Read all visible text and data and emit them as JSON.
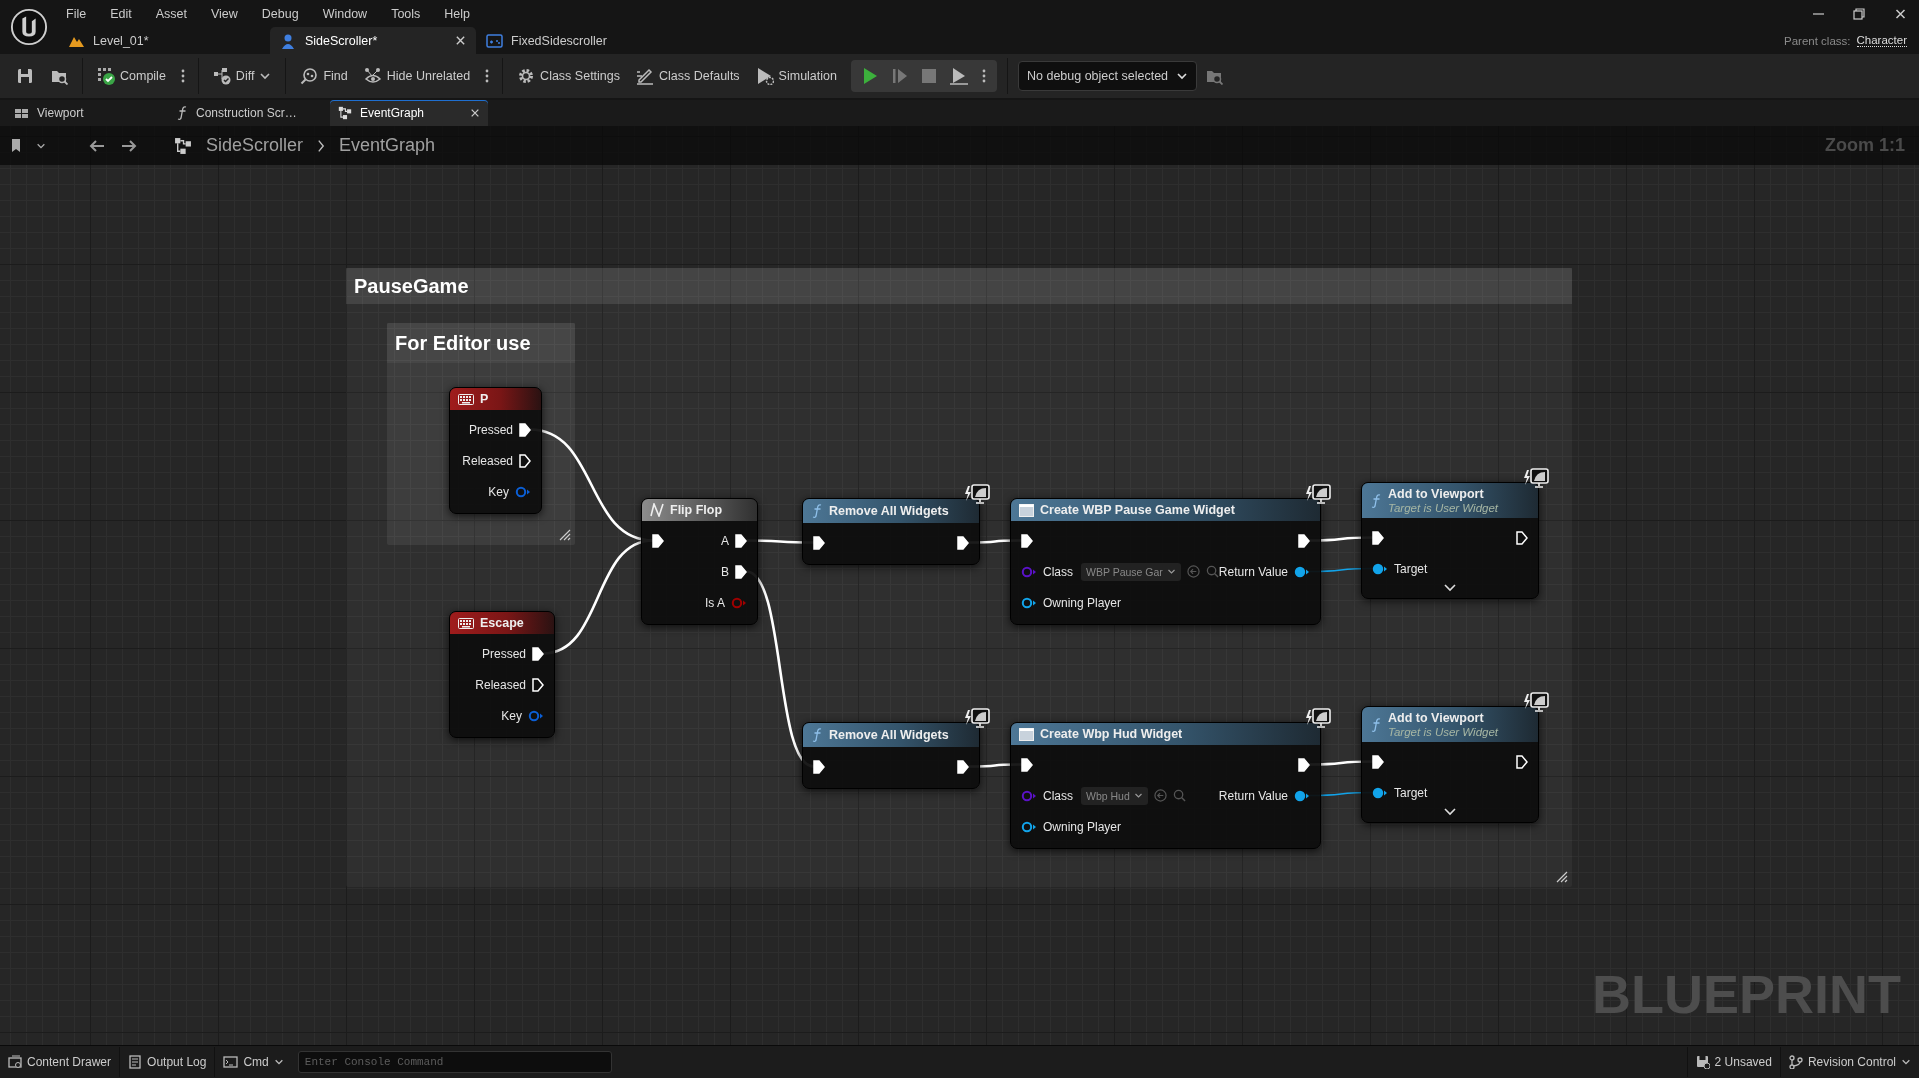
{
  "menu": [
    "File",
    "Edit",
    "Asset",
    "View",
    "Debug",
    "Window",
    "Tools",
    "Help"
  ],
  "document_tabs": [
    {
      "label": "Level_01*",
      "selected": false
    },
    {
      "label": "SideScroller*",
      "selected": true
    },
    {
      "label": "FixedSidescroller",
      "selected": false
    }
  ],
  "parent_class": {
    "label": "Parent class:",
    "value": "Character"
  },
  "toolbar": {
    "compile": "Compile",
    "diff": "Diff",
    "find": "Find",
    "hide_unrelated": "Hide Unrelated",
    "class_settings": "Class Settings",
    "class_defaults": "Class Defaults",
    "simulation": "Simulation",
    "debug_object": "No debug object selected"
  },
  "graph_tabs": [
    {
      "label": "Viewport",
      "selected": false
    },
    {
      "label": "Construction Scr…",
      "selected": false
    },
    {
      "label": "EventGraph",
      "selected": true
    }
  ],
  "breadcrumb": [
    "SideScroller",
    "EventGraph"
  ],
  "zoom_label": "Zoom 1:1",
  "comments": [
    {
      "title": "PauseGame"
    },
    {
      "title": "For Editor use"
    }
  ],
  "nodes": [
    {
      "kind": "event",
      "title": "P",
      "ui_badge": false,
      "outputs": [
        {
          "label": "Pressed",
          "kind": "exec",
          "connected": true
        },
        {
          "label": "Released",
          "kind": "exec",
          "connected": false
        },
        {
          "label": "Key",
          "kind": "struct",
          "connected": false
        }
      ]
    },
    {
      "kind": "event",
      "title": "Escape",
      "ui_badge": false,
      "outputs": [
        {
          "label": "Pressed",
          "kind": "exec",
          "connected": true
        },
        {
          "label": "Released",
          "kind": "exec",
          "connected": false
        },
        {
          "label": "Key",
          "kind": "struct",
          "connected": false
        }
      ]
    },
    {
      "kind": "macro",
      "title": "Flip Flop",
      "ui_badge": false,
      "inputs": [
        {
          "kind": "exec",
          "connected": true
        }
      ],
      "outputs": [
        {
          "label": "A",
          "kind": "exec",
          "connected": true
        },
        {
          "label": "B",
          "kind": "exec",
          "connected": true
        },
        {
          "label": "Is A",
          "kind": "bool",
          "connected": false
        }
      ]
    },
    {
      "kind": "function",
      "title": "Remove All Widgets",
      "ui_badge": true,
      "inputs": [
        {
          "kind": "exec",
          "connected": true
        }
      ],
      "outputs": [
        {
          "kind": "exec",
          "connected": true
        }
      ]
    },
    {
      "kind": "create",
      "title": "Create WBP Pause Game Widget",
      "ui_badge": true,
      "inputs": [
        {
          "kind": "exec",
          "connected": true
        },
        {
          "label": "Class",
          "kind": "class",
          "connected": false,
          "default": "WBP Pause Gar"
        },
        {
          "label": "Owning Player",
          "kind": "object",
          "connected": false
        }
      ],
      "outputs": [
        {
          "kind": "exec",
          "connected": true
        },
        {
          "label": "Return Value",
          "kind": "object",
          "connected": true
        }
      ]
    },
    {
      "kind": "function",
      "title": "Add to Viewport",
      "subtitle": "Target is User Widget",
      "ui_badge": true,
      "expander": true,
      "inputs": [
        {
          "kind": "exec",
          "connected": true
        },
        {
          "label": "Target",
          "kind": "object",
          "connected": true
        }
      ],
      "outputs": [
        {
          "kind": "exec",
          "connected": false
        }
      ]
    },
    {
      "kind": "function",
      "title": "Remove All Widgets",
      "ui_badge": true,
      "inputs": [
        {
          "kind": "exec",
          "connected": true
        }
      ],
      "outputs": [
        {
          "kind": "exec",
          "connected": true
        }
      ]
    },
    {
      "kind": "create",
      "title": "Create Wbp Hud Widget",
      "ui_badge": true,
      "inputs": [
        {
          "kind": "exec",
          "connected": true
        },
        {
          "label": "Class",
          "kind": "class",
          "connected": false,
          "default": "Wbp Hud"
        },
        {
          "label": "Owning Player",
          "kind": "object",
          "connected": false
        }
      ],
      "outputs": [
        {
          "kind": "exec",
          "connected": true
        },
        {
          "label": "Return Value",
          "kind": "object",
          "connected": true
        }
      ]
    },
    {
      "kind": "function",
      "title": "Add to Viewport",
      "subtitle": "Target is User Widget",
      "ui_badge": true,
      "expander": true,
      "inputs": [
        {
          "kind": "exec",
          "connected": true
        },
        {
          "label": "Target",
          "kind": "object",
          "connected": true
        }
      ],
      "outputs": [
        {
          "kind": "exec",
          "connected": false
        }
      ]
    }
  ],
  "watermark": "BLUEPRINT",
  "status_bar": {
    "content_drawer": "Content Drawer",
    "output_log": "Output Log",
    "cmd": "Cmd",
    "console_placeholder": "Enter Console Command",
    "unsaved": "2 Unsaved",
    "revision_control": "Revision Control"
  }
}
